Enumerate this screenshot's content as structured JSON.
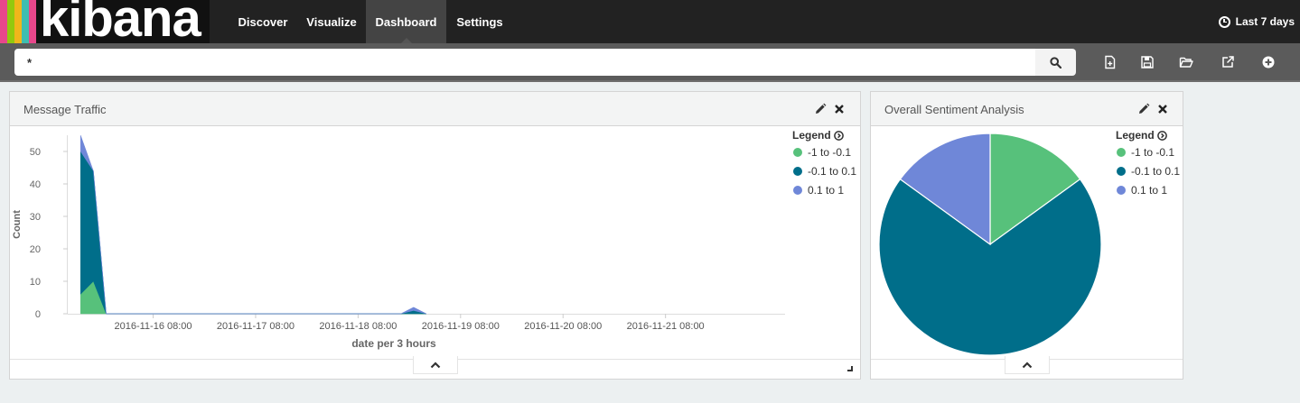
{
  "app": {
    "logo_text": "kibana",
    "logo_colors": [
      "#e8478b",
      "#3ebeb0",
      "#f0b61b",
      "#93c90e",
      "#e8478b"
    ]
  },
  "nav": {
    "tabs": [
      {
        "label": "Discover"
      },
      {
        "label": "Visualize"
      },
      {
        "label": "Dashboard",
        "active": true
      },
      {
        "label": "Settings"
      }
    ],
    "timepicker_label": "Last 7 days"
  },
  "search": {
    "value": "*",
    "button_icon": "search-icon"
  },
  "toolbar": {
    "icons": [
      "new-dashboard-icon",
      "save-icon",
      "open-icon",
      "share-icon",
      "add-panel-icon"
    ]
  },
  "colors": {
    "series1": "#57c17b",
    "series2": "#006e8a",
    "series3": "#6f87d8"
  },
  "panels": {
    "traffic": {
      "title": "Message Traffic"
    },
    "sentiment": {
      "title": "Overall Sentiment Analysis"
    }
  },
  "legend": {
    "title": "Legend",
    "items": [
      {
        "label": "-1 to -0.1"
      },
      {
        "label": "-0.1 to 0.1"
      },
      {
        "label": "0.1 to 1"
      }
    ]
  },
  "chart_data": [
    {
      "type": "area",
      "stacked": true,
      "ylabel": "Count",
      "xlabel": "date per 3 hours",
      "ylim": [
        0,
        55
      ],
      "yticks": [
        0,
        10,
        20,
        30,
        40,
        50
      ],
      "xlim": [
        "2016-11-15 12:00",
        "2016-11-22 12:00"
      ],
      "xticks": [
        "2016-11-16 08:00",
        "2016-11-17 08:00",
        "2016-11-18 08:00",
        "2016-11-19 08:00",
        "2016-11-20 08:00",
        "2016-11-21 08:00"
      ],
      "x": [
        "2016-11-15 15:00",
        "2016-11-15 18:00",
        "2016-11-15 21:00",
        "2016-11-18 18:00",
        "2016-11-18 21:00",
        "2016-11-19 00:00"
      ],
      "series": [
        {
          "name": "-1 to -0.1",
          "values": [
            6,
            10,
            0,
            0,
            0,
            0
          ]
        },
        {
          "name": "-0.1 to 0.1",
          "values": [
            44,
            34,
            0,
            0,
            1,
            0
          ]
        },
        {
          "name": "0.1 to 1",
          "values": [
            5,
            0,
            0,
            0,
            1,
            0
          ]
        }
      ]
    },
    {
      "type": "pie",
      "slices": [
        {
          "name": "-1 to -0.1",
          "value": 15
        },
        {
          "name": "-0.1 to 0.1",
          "value": 70
        },
        {
          "name": "0.1 to 1",
          "value": 15
        }
      ]
    }
  ]
}
